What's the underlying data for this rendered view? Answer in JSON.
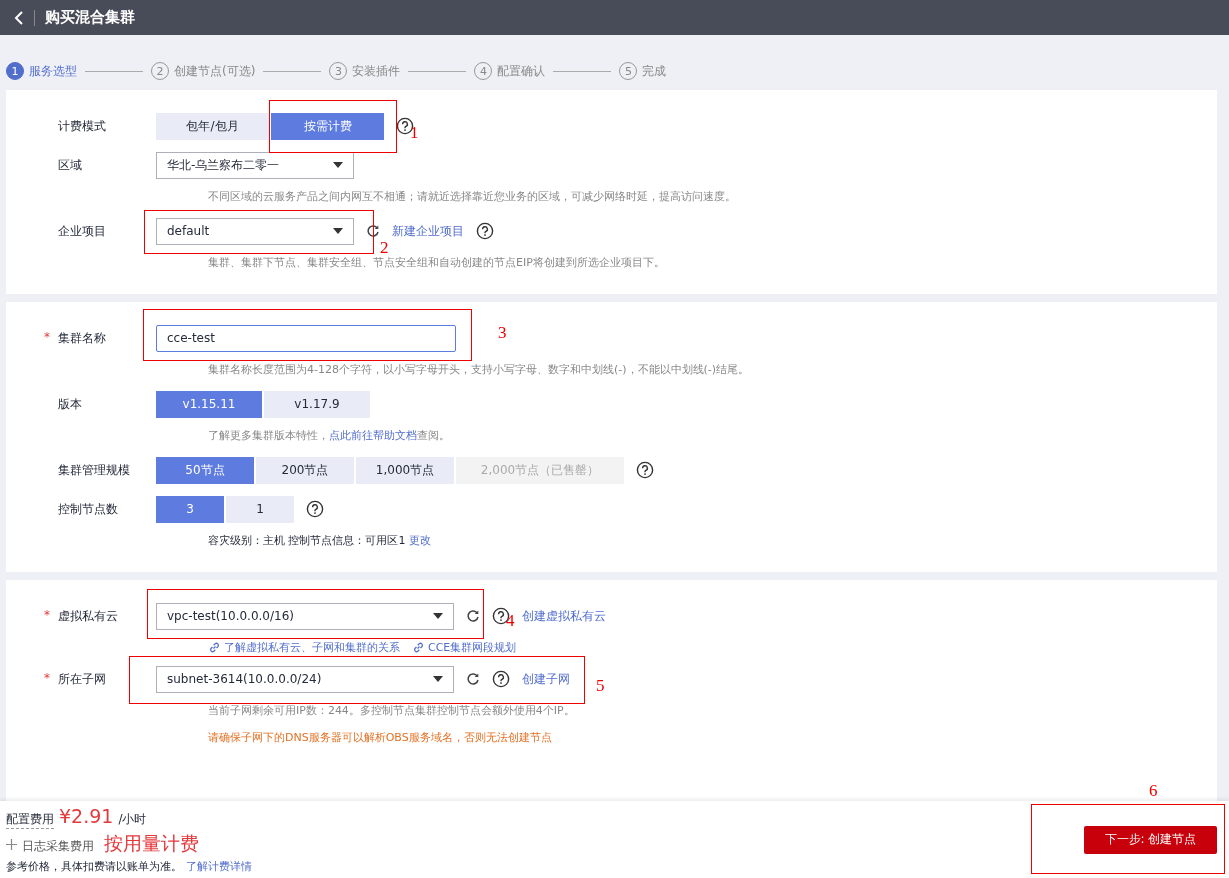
{
  "header": {
    "title": "购买混合集群"
  },
  "steps": [
    {
      "number": "1",
      "label": "服务选型",
      "selected": true
    },
    {
      "number": "2",
      "label": "创建节点(可选)",
      "selected": false
    },
    {
      "number": "3",
      "label": "安装插件",
      "selected": false
    },
    {
      "number": "4",
      "label": "配置确认",
      "selected": false
    },
    {
      "number": "5",
      "label": "完成",
      "selected": false
    }
  ],
  "billing": {
    "label": "计费模式",
    "options": [
      {
        "label": "包年/包月",
        "selected": false
      },
      {
        "label": "按需计费",
        "selected": true
      }
    ]
  },
  "region": {
    "label": "区域",
    "value": "华北-乌兰察布二零一",
    "hint": "不同区域的云服务产品之间内网互不相通；请就近选择靠近您业务的区域，可减少网络时延，提高访问速度。"
  },
  "enterprise_project": {
    "label": "企业项目",
    "value": "default",
    "link": "新建企业项目",
    "hint": "集群、集群下节点、集群安全组、节点安全组和自动创建的节点EIP将创建到所选企业项目下。"
  },
  "cluster_name": {
    "label": "集群名称",
    "required_mark": "*",
    "value": "cce-test",
    "hint": "集群名称长度范围为4-128个字符，以小写字母开头，支持小写字母、数字和中划线(-)，不能以中划线(-)结尾。"
  },
  "version": {
    "label": "版本",
    "options": [
      {
        "label": "v1.15.11",
        "selected": true
      },
      {
        "label": "v1.17.9",
        "selected": false
      }
    ],
    "hint": "了解更多集群版本特性，",
    "hint_link": "点此前往帮助文档",
    "hint_end": "查阅。"
  },
  "scale": {
    "label": "集群管理规模",
    "options": [
      {
        "label": "50节点",
        "selected": true,
        "disabled": false
      },
      {
        "label": "200节点",
        "selected": false,
        "disabled": false
      },
      {
        "label": "1,000节点",
        "selected": false,
        "disabled": false
      },
      {
        "label": "2,000节点（已售罄）",
        "selected": false,
        "disabled": true
      }
    ]
  },
  "control_nodes": {
    "label": "控制节点数",
    "options": [
      {
        "label": "3",
        "selected": true
      },
      {
        "label": "1",
        "selected": false
      }
    ],
    "info": "容灾级别：主机   控制节点信息：可用区1",
    "info_link": "更改"
  },
  "vpc": {
    "label": "虚拟私有云",
    "required_mark": "*",
    "value": "vpc-test(10.0.0.0/16)",
    "link": "创建虚拟私有云",
    "help_links": [
      "了解虚拟私有云、子网和集群的关系",
      "CCE集群网段规划"
    ]
  },
  "subnet": {
    "label": "所在子网",
    "required_mark": "*",
    "value": "subnet-3614(10.0.0.0/24)",
    "link": "创建子网",
    "hint": "当前子网剩余可用IP数：244。多控制节点集群控制节点会额外使用4个IP。",
    "warning": "请确保子网下的DNS服务器可以解析OBS服务域名，否则无法创建节点"
  },
  "footer": {
    "config_fee_label": "配置费用",
    "price": "¥2.91",
    "price_unit": "/小时",
    "log_fee_label": "日志采集费用",
    "log_fee_value": "按用量计费",
    "note": "参考价格，具体扣费请以账单为准。",
    "note_link": "了解计费详情",
    "next_button": "下一步: 创建节点"
  },
  "annotations": [
    {
      "label": "1"
    },
    {
      "label": "2"
    },
    {
      "label": "3"
    },
    {
      "label": "4"
    },
    {
      "label": "5"
    },
    {
      "label": "6"
    }
  ]
}
